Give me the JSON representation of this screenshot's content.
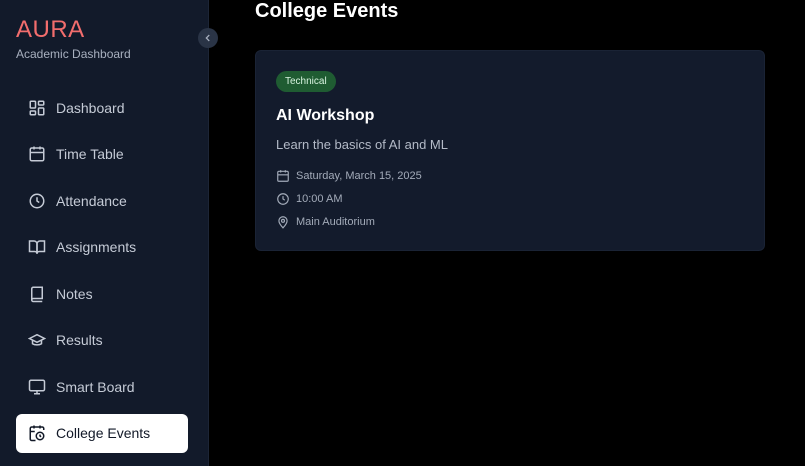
{
  "brand": {
    "title": "AURA",
    "subtitle": "Academic Dashboard"
  },
  "sidebar": {
    "collapse_icon": "chevron-left-icon",
    "items": [
      {
        "label": "Dashboard",
        "icon": "dashboard-grid-icon",
        "active": false
      },
      {
        "label": "Time Table",
        "icon": "calendar-icon",
        "active": false
      },
      {
        "label": "Attendance",
        "icon": "clock-icon",
        "active": false
      },
      {
        "label": "Assignments",
        "icon": "open-book-icon",
        "active": false
      },
      {
        "label": "Notes",
        "icon": "book-icon",
        "active": false
      },
      {
        "label": "Results",
        "icon": "graduation-cap-icon",
        "active": false
      },
      {
        "label": "Smart Board",
        "icon": "monitor-icon",
        "active": false
      },
      {
        "label": "College Events",
        "icon": "calendar-clock-icon",
        "active": true
      }
    ]
  },
  "main": {
    "title": "College Events",
    "events": [
      {
        "badge": "Technical",
        "title": "AI Workshop",
        "description": "Learn the basics of AI and ML",
        "date": "Saturday, March 15, 2025",
        "time": "10:00 AM",
        "location": "Main Auditorium"
      }
    ]
  },
  "colors": {
    "brand": "#f26d6d",
    "sidebar_bg": "#121a2a",
    "card_bg": "#131b2c",
    "badge_bg": "#1f5c32",
    "page_bg": "#000000"
  }
}
